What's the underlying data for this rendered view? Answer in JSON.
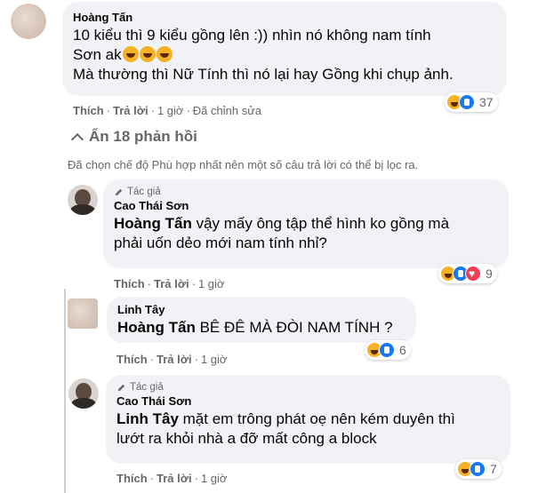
{
  "comments": [
    {
      "author": "Hoàng Tấn",
      "lines": [
        "10 kiểu thì 9 kiểu gồng lên :)) nhìn nó không nam tính",
        "Sơn ak",
        "Mà thường thì Nữ Tính thì nó lại hay Gồng khi chụp ảnh."
      ],
      "actions": {
        "like": "Thích",
        "reply": "Trả lời",
        "time": "1 giờ",
        "edited": "Đã chỉnh sửa"
      },
      "reactions": {
        "types": [
          "haha-icon",
          "like-icon"
        ],
        "count": "37"
      }
    },
    {
      "badge": "Tác giả",
      "author": "Cao Thái Sơn",
      "mention": "Hoàng Tấn",
      "line1": "vậy mấy ông tập thể hình ko gồng mà",
      "line2": "phải uốn dẻo mới nam tính nhỉ?",
      "actions": {
        "like": "Thích",
        "reply": "Trả lời",
        "time": "1 giờ"
      },
      "reactions": {
        "types": [
          "haha-icon",
          "like-icon",
          "love-icon"
        ],
        "count": "9"
      }
    },
    {
      "author": "Linh Tây",
      "mention": "Hoàng Tấn",
      "line1": "BÊ ĐÊ MÀ ĐÒI NAM TÍNH ?",
      "actions": {
        "like": "Thích",
        "reply": "Trả lời",
        "time": "1 giờ"
      },
      "reactions": {
        "types": [
          "haha-icon",
          "like-icon"
        ],
        "count": "6"
      }
    },
    {
      "badge": "Tác giả",
      "author": "Cao Thái Sơn",
      "mention": "Linh Tây",
      "line1": "mặt em trông phát oẹ nên kém duyên thì",
      "line2": "lướt ra khỏi nhà a đỡ mất công a block",
      "actions": {
        "like": "Thích",
        "reply": "Trả lời",
        "time": "1 giờ"
      },
      "reactions": {
        "types": [
          "haha-icon",
          "like-icon"
        ],
        "count": "7"
      }
    }
  ],
  "hide_replies": "Ẩn 18 phản hồi",
  "filter_note": "Đã chọn chế độ Phù hợp nhất nên một số câu trả lời có thể bị lọc ra.",
  "colors": {
    "bubble": "#f0f2f5",
    "secondary_text": "#65676b",
    "like": "#1877f2",
    "haha": "#f7b125",
    "love": "#f33e58"
  }
}
